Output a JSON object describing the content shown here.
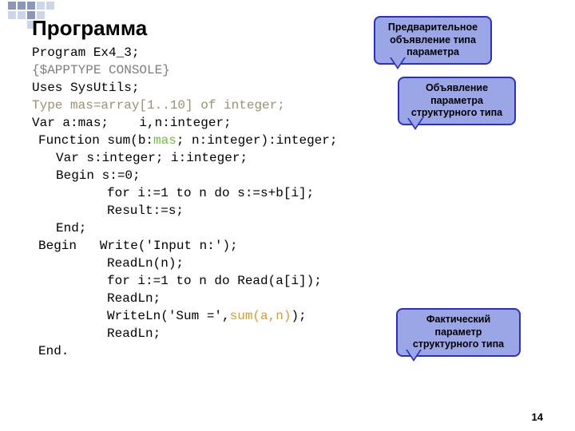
{
  "title": "Программа",
  "code": {
    "l1": "Program Ex4_3;",
    "l2": "{$APPTYPE CONSOLE}",
    "l3": "Uses SysUtils;",
    "l4": "Type mas=array[1..10] of integer;",
    "l5a": "Var a:mas;",
    "l5b": "i,n:integer;",
    "l6a": "Function sum(b:",
    "l6b": "mas",
    "l6c": "; n:integer):integer;",
    "l7": "Var s:integer; i:integer;",
    "l8": "Begin s:=0;",
    "l9": "for i:=1 to n do s:=s+b[i];",
    "l10": "Result:=s;",
    "l11": "End;",
    "l12a": "Begin",
    "l12b": "Write('Input n:');",
    "l13": "ReadLn(n);",
    "l14": "for i:=1 to n do Read(a[i]);",
    "l15": "ReadLn;",
    "l16a": "WriteLn('Sum =',",
    "l16b": "sum(a,n)",
    "l16c": ");",
    "l17": "ReadLn;",
    "l18": "End."
  },
  "callouts": {
    "c1": {
      "l1": "Предварительное",
      "l2": "объявление типа",
      "l3": "параметра"
    },
    "c2": {
      "l1": "Объявление",
      "l2": "параметра",
      "l3": "структурного типа"
    },
    "c3": {
      "l1": "Фактический",
      "l2": "параметр",
      "l3": "структурного типа"
    }
  },
  "pagenum": "14"
}
